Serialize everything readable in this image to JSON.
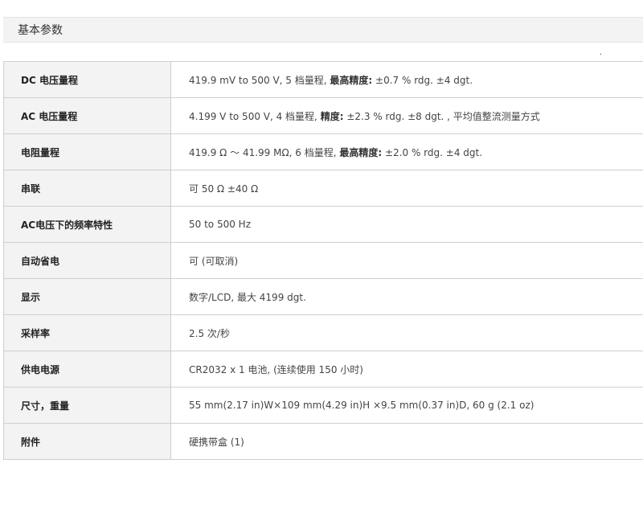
{
  "section": {
    "title": "基本参数",
    "mark": "."
  },
  "rows": [
    {
      "label": "DC 电压量程",
      "value_a": "419.9 mV to 500 V, 5 档量程, ",
      "value_b": "最高精度:",
      "value_c": " ±0.7 % rdg. ±4 dgt."
    },
    {
      "label": "AC 电压量程",
      "value_a": "4.199 V to 500 V, 4 档量程, ",
      "value_b": "精度:",
      "value_c": " ±2.3 % rdg. ±8 dgt. , 平均值整流测量方式"
    },
    {
      "label": "电阻量程",
      "value_a": "419.9 Ω ～ 41.99 MΩ, 6 档量程, ",
      "value_b": "最高精度:",
      "value_c": " ±2.0 % rdg. ±4 dgt."
    },
    {
      "label": "串联",
      "value_a": "可 50 Ω ±40 Ω",
      "value_b": "",
      "value_c": ""
    },
    {
      "label": "AC电压下的频率特性",
      "value_a": "50 to 500 Hz",
      "value_b": "",
      "value_c": ""
    },
    {
      "label": "自动省电",
      "value_a": "可 (可取消)",
      "value_b": "",
      "value_c": ""
    },
    {
      "label": "显示",
      "value_a": "数字/LCD, 最大 4199 dgt.",
      "value_b": "",
      "value_c": ""
    },
    {
      "label": "采样率",
      "value_a": "2.5 次/秒",
      "value_b": "",
      "value_c": ""
    },
    {
      "label": "供电电源",
      "value_a": "CR2032 x 1 电池, (连续使用 150 小时)",
      "value_b": "",
      "value_c": ""
    },
    {
      "label": "尺寸，重量",
      "value_a": "55 mm(2.17 in)W×109 mm(4.29 in)H ×9.5 mm(0.37 in)D, 60 g (2.1 oz)",
      "value_b": "",
      "value_c": ""
    },
    {
      "label": "附件",
      "value_a": "硬携带盒 (1)",
      "value_b": "",
      "value_c": ""
    }
  ]
}
